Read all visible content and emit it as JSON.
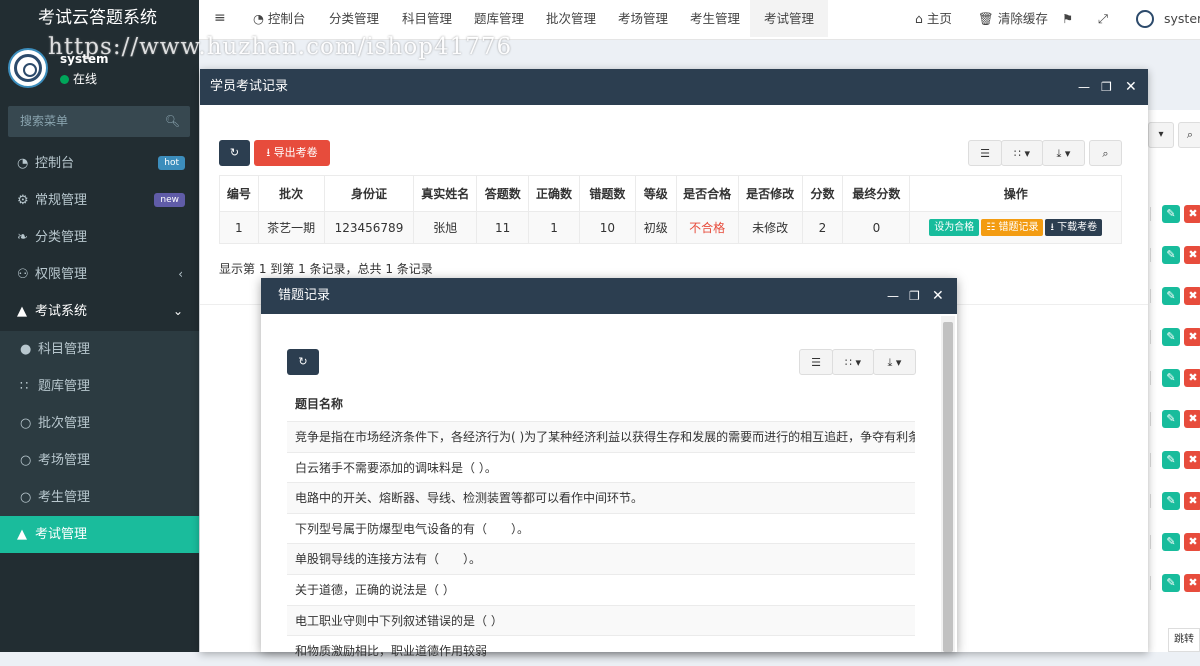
{
  "app": {
    "title": "考试云答题系统"
  },
  "watermark": "https://www.huzhan.com/ishop41776",
  "user": {
    "name": "system",
    "status": "在线"
  },
  "search": {
    "placeholder": "搜索菜单"
  },
  "sidebar": {
    "items": [
      {
        "label": "控制台",
        "icon": "dashboard-icon",
        "badge": "hot",
        "badge_color": "#3c8dbc"
      },
      {
        "label": "常规管理",
        "icon": "cogs-icon",
        "badge": "new",
        "badge_color": "#605ca8"
      },
      {
        "label": "分类管理",
        "icon": "leaf-icon"
      },
      {
        "label": "权限管理",
        "icon": "group-icon"
      },
      {
        "label": "考试系统",
        "icon": "graduation-cap-icon"
      }
    ],
    "sub_items": [
      {
        "label": "科目管理",
        "icon": "map-marker-icon"
      },
      {
        "label": "题库管理",
        "icon": "th-icon"
      },
      {
        "label": "批次管理",
        "icon": "circle-icon"
      },
      {
        "label": "考场管理",
        "icon": "circle-icon"
      },
      {
        "label": "考生管理",
        "icon": "circle-icon"
      }
    ],
    "active_item": {
      "label": "考试管理",
      "icon": "graduation-cap-icon"
    }
  },
  "topnav": {
    "tabs": [
      "控制台",
      "分类管理",
      "科目管理",
      "题库管理",
      "批次管理",
      "考场管理",
      "考生管理",
      "考试管理"
    ],
    "home": "主页",
    "clear_cache": "清除缓存",
    "user": "system"
  },
  "exam_window": {
    "title": "学员考试记录",
    "export_label": "导出考卷",
    "columns": [
      "编号",
      "批次",
      "身份证",
      "真实姓名",
      "答题数",
      "正确数",
      "错题数",
      "等级",
      "是否合格",
      "是否修改",
      "分数",
      "最终分数",
      "操作"
    ],
    "rows": [
      {
        "id": "1",
        "batch": "茶艺一期",
        "idcard": "123456789",
        "name": "张旭",
        "answered": "11",
        "correct": "1",
        "wrong": "10",
        "level": "初级",
        "pass": "不合格",
        "modified": "未修改",
        "score": "2",
        "final": "0"
      }
    ],
    "actions": [
      "设为合格",
      "错题记录",
      "下载考卷"
    ],
    "pagination": "显示第 1 到第 1 条记录，总共 1 条记录",
    "colors": {
      "pass_fail": "#e74c3c",
      "set_pass": "#18bc9c",
      "wrong_record": "#f39c12",
      "download": "#2c3e50"
    }
  },
  "wrong_window": {
    "title": "错题记录",
    "column": "题目名称",
    "rows": [
      "竞争是指在市场经济条件下，各经济行为( )为了某种经济利益以获得生存和发展的需要而进行的相互追赶，争夺有利条件的优",
      "白云猪手不需要添加的调味料是（ ）。",
      "电路中的开关、熔断器、导线、检测装置等都可以看作中间环节。",
      "下列型号属于防爆型电气设备的有（　　）。",
      "单股铜导线的连接方法有（　　）。",
      "关于道德，正确的说法是（ ）",
      "电工职业守则中下列叙述错误的是（ ）",
      "和物质激励相比，职业道德作用较弱"
    ]
  },
  "background": {
    "footer_label": "跳转"
  }
}
